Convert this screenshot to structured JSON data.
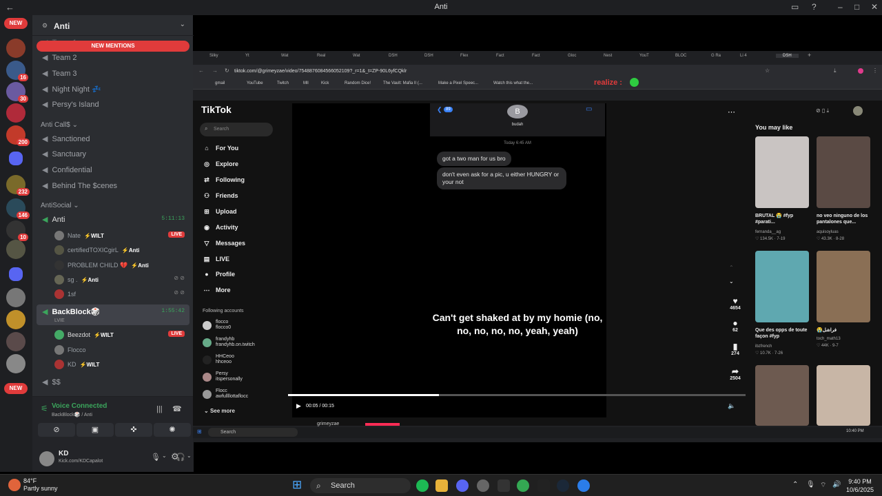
{
  "window": {
    "title": "Anti"
  },
  "rail": {
    "new_top": "NEW",
    "new_bottom": "NEW",
    "badges": [
      "16",
      "30",
      "200",
      "232",
      "146",
      "10"
    ]
  },
  "server": {
    "name": "Anti",
    "new_mentions": "NEW MENTIONS",
    "team_top": "Team 1",
    "channels_top": [
      "Team 2",
      "Team 3",
      "Night Night 💤",
      "Persy's Island"
    ],
    "cat_call": "Anti Call$ ⌄",
    "channels_call": [
      "Sanctioned",
      "Sanctuary",
      "Confidential",
      "Behind The $cenes"
    ],
    "cat_social": "AntiSocial ⌄",
    "voice_anti": {
      "name": "Anti",
      "time": "5:11:13"
    },
    "anti_users": [
      {
        "name": "Nate",
        "tag": "⚡WILT",
        "live": "LIVE"
      },
      {
        "name": "certifiedTOXICgirL",
        "tag": "⚡Anti",
        "live": ""
      },
      {
        "name": "PROBLEM CHILD 💔",
        "tag": "⚡Anti",
        "live": ""
      },
      {
        "name": "sg .",
        "tag": "⚡Anti",
        "live": ""
      },
      {
        "name": "1sf",
        "tag": "",
        "live": ""
      }
    ],
    "voice_back": {
      "name": "BackBlock🎲",
      "time": "1:55:42",
      "sub": "LVIE"
    },
    "back_users": [
      {
        "name": "Beezdot",
        "tag": "⚡WILT",
        "live": "LIVE"
      },
      {
        "name": "Flocco",
        "tag": "",
        "live": ""
      },
      {
        "name": "KD",
        "tag": "⚡WILT",
        "live": ""
      }
    ],
    "channel_dollar": "$$"
  },
  "voice": {
    "status": "Voice Connected",
    "location": "BackBlock🎲 / Anti"
  },
  "user": {
    "name": "KD",
    "status": "Kick.com/KDCapalot"
  },
  "browser": {
    "tabs": [
      "Silky",
      "Yt",
      "Wat",
      "Real",
      "Wat",
      "DSH",
      "DSH",
      "Flex",
      "Fact",
      "Fact",
      "Gloc",
      "Nest",
      "YouT",
      "BLOC",
      "G Ra",
      "Li 4",
      "DSH"
    ],
    "url": "tiktok.com/@grimeyzae/video/7548876084566052109?_r=1&_t=ZP-90L6yfCQklr",
    "overlay_text": "realize :",
    "bookmarks": [
      "gmail",
      "YouTube",
      "Twitch",
      "Mll",
      "Kick",
      "Random Dice!",
      "The Vault: Mafia II (...",
      "Make a Pixel Speec...",
      "Watch this what the..."
    ]
  },
  "tiktok": {
    "logo": "TikTok",
    "search_placeholder": "Search",
    "nav": [
      "For You",
      "Explore",
      "Following",
      "Friends",
      "Upload",
      "Activity",
      "Messages",
      "LIVE",
      "Profile",
      "More"
    ],
    "following_header": "Following accounts",
    "following": [
      {
        "name": "flocco",
        "handle": "flocco0"
      },
      {
        "name": "frandyhb",
        "handle": "frandyhb.on.twitch"
      },
      {
        "name": "HHCeoo",
        "handle": "hhceoo"
      },
      {
        "name": "Persy",
        "handle": "itspersonally"
      },
      {
        "name": "Flocc",
        "handle": "awfullllottaflocc"
      }
    ],
    "see_more": "See more",
    "video": {
      "contact_initial": "B",
      "contact_name": "budah",
      "back_count": "89",
      "timestamp": "Today 6:45 AM",
      "msg1": "got a two man for us bro",
      "msg2": "don't even ask for a pic, u either HUNGRY or your not",
      "lyric": "Can't get shaked at by my homie (no, no, no, no, no, yeah, yeah)",
      "time": "00:05 / 00:15",
      "progress": 0.33,
      "author": "grimeyzae"
    },
    "actions": {
      "likes": "4654",
      "comments": "62",
      "saves": "274",
      "shares": "2504"
    },
    "you_may_like": "You may like",
    "recs": [
      {
        "caption": "BRUTAL 😭 #fyp #parati...",
        "author": "fernanda__ag",
        "stats": "♡ 134.5K · 7-19",
        "color": "#c9c4c2"
      },
      {
        "caption": "no veo ninguno de los pantalones que...",
        "author": "aquisoyluas",
        "stats": "♡ 43.3K · 8-28",
        "color": "#5a4a44"
      },
      {
        "caption": "Que des opps de toute façon #fyp",
        "author": "ibzfrench",
        "stats": "♡ 10.7K · 7-26",
        "color": "#5fa8b0"
      },
      {
        "caption": "😭فراشل",
        "author": "toch_math13",
        "stats": "♡ 44K · 9-7",
        "color": "#8a6f55"
      },
      {
        "caption": "",
        "author": "",
        "stats": "",
        "color": "#6d5a50"
      },
      {
        "caption": "",
        "author": "",
        "stats": "",
        "color": "#c8b6a6"
      }
    ]
  },
  "inner_taskbar": {
    "search": "Search",
    "time": "10:40 PM"
  },
  "taskbar": {
    "weather_temp": "84°F",
    "weather_desc": "Partly sunny",
    "search": "Search",
    "time": "9:40 PM",
    "date": "10/6/2025"
  },
  "colors": {
    "discord_bg": "#2b2d31",
    "rail_bg": "#1e1f22",
    "live_red": "#e03b3b",
    "voice_green": "#3ba55c",
    "tiktok_pink": "#fe2c55"
  }
}
